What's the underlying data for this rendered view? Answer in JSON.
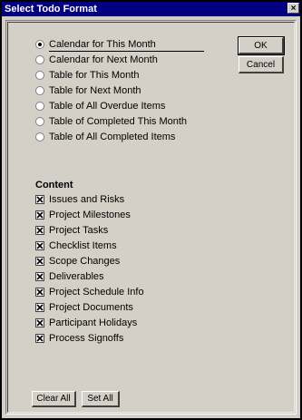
{
  "window": {
    "title": "Select Todo Format",
    "close_glyph": "×"
  },
  "format_options": [
    {
      "label": "Calendar for This Month",
      "selected": true
    },
    {
      "label": "Calendar for Next Month",
      "selected": false
    },
    {
      "label": "Table for This Month",
      "selected": false
    },
    {
      "label": "Table for Next Month",
      "selected": false
    },
    {
      "label": "Table of All Overdue Items",
      "selected": false
    },
    {
      "label": "Table of Completed This Month",
      "selected": false
    },
    {
      "label": "Table of All Completed Items",
      "selected": false
    }
  ],
  "content": {
    "heading": "Content",
    "items": [
      {
        "label": "Issues and Risks",
        "checked": true
      },
      {
        "label": "Project Milestones",
        "checked": true
      },
      {
        "label": "Project Tasks",
        "checked": true
      },
      {
        "label": "Checklist Items",
        "checked": true
      },
      {
        "label": "Scope Changes",
        "checked": true
      },
      {
        "label": "Deliverables",
        "checked": true
      },
      {
        "label": "Project Schedule Info",
        "checked": true
      },
      {
        "label": "Project Documents",
        "checked": true
      },
      {
        "label": "Participant Holidays",
        "checked": true
      },
      {
        "label": "Process Signoffs",
        "checked": true
      }
    ]
  },
  "buttons": {
    "ok": "OK",
    "cancel": "Cancel",
    "clear_all": "Clear All",
    "set_all": "Set All"
  }
}
